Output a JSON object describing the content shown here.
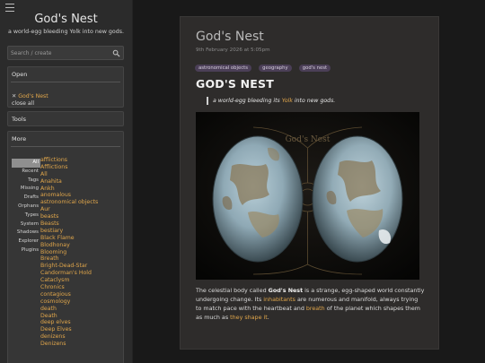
{
  "site": {
    "title": "God's Nest",
    "subtitle": "a world-egg bleeding Yolk into new gods."
  },
  "search": {
    "placeholder": "Search / create"
  },
  "panels": {
    "open": "Open",
    "tools": "Tools",
    "more": "More"
  },
  "open_tiddlers": {
    "item": "God's Nest",
    "close_all": "close all"
  },
  "more_tabs": [
    "All",
    "Recent",
    "Tags",
    "Missing",
    "Drafts",
    "Orphans",
    "Types",
    "System",
    "Shadows",
    "Explorer",
    "Plugins"
  ],
  "tags_list": [
    "afflictions",
    "Afflictions",
    "All",
    "Anahita",
    "Ankh",
    "anomalous",
    "astronomical objects",
    "Aur",
    "beasts",
    "Beasts",
    "bestiary",
    "Black Flame",
    "Blodhonay",
    "Blooming",
    "Breath",
    "Bright-Dead-Star",
    "Candorman's Hold",
    "Cataclysm",
    "Chronics",
    "contagious",
    "cosmology",
    "death",
    "Death",
    "deep elves",
    "Deep Elves",
    "denizens",
    "Denizens"
  ],
  "article": {
    "title": "God's Nest",
    "date": "9th February 2026 at 5:05pm",
    "tags": [
      "astronomical objects",
      "geography",
      "god's nest"
    ],
    "heading": "GOD'S NEST",
    "quote_pre": "a world-egg bleeding its ",
    "quote_link": "Yolk",
    "quote_post": " into new gods.",
    "image_caption": "God's Nest",
    "body": {
      "p1": "The celestial body called ",
      "p1_bold": "God's Nest",
      "p2": " is a strange, egg-shaped world constantly undergoing change. Its ",
      "link_inhabitants": "inhabitants",
      "p3": " are numerous and manifold, always trying to match pace with the heartbeat and ",
      "link_breath": "breath",
      "p4": " of the planet which shapes them as much as ",
      "link_shape": "they shape it",
      "p5": "."
    }
  },
  "colors": {
    "accent": "#e0a64b",
    "tag_chip": "#4b3f57",
    "card": "#2e2c2b",
    "sidebar": "#2b2b2b"
  },
  "icons": {
    "menu": "hamburger-icon",
    "search": "search-icon",
    "close": "close-icon"
  }
}
